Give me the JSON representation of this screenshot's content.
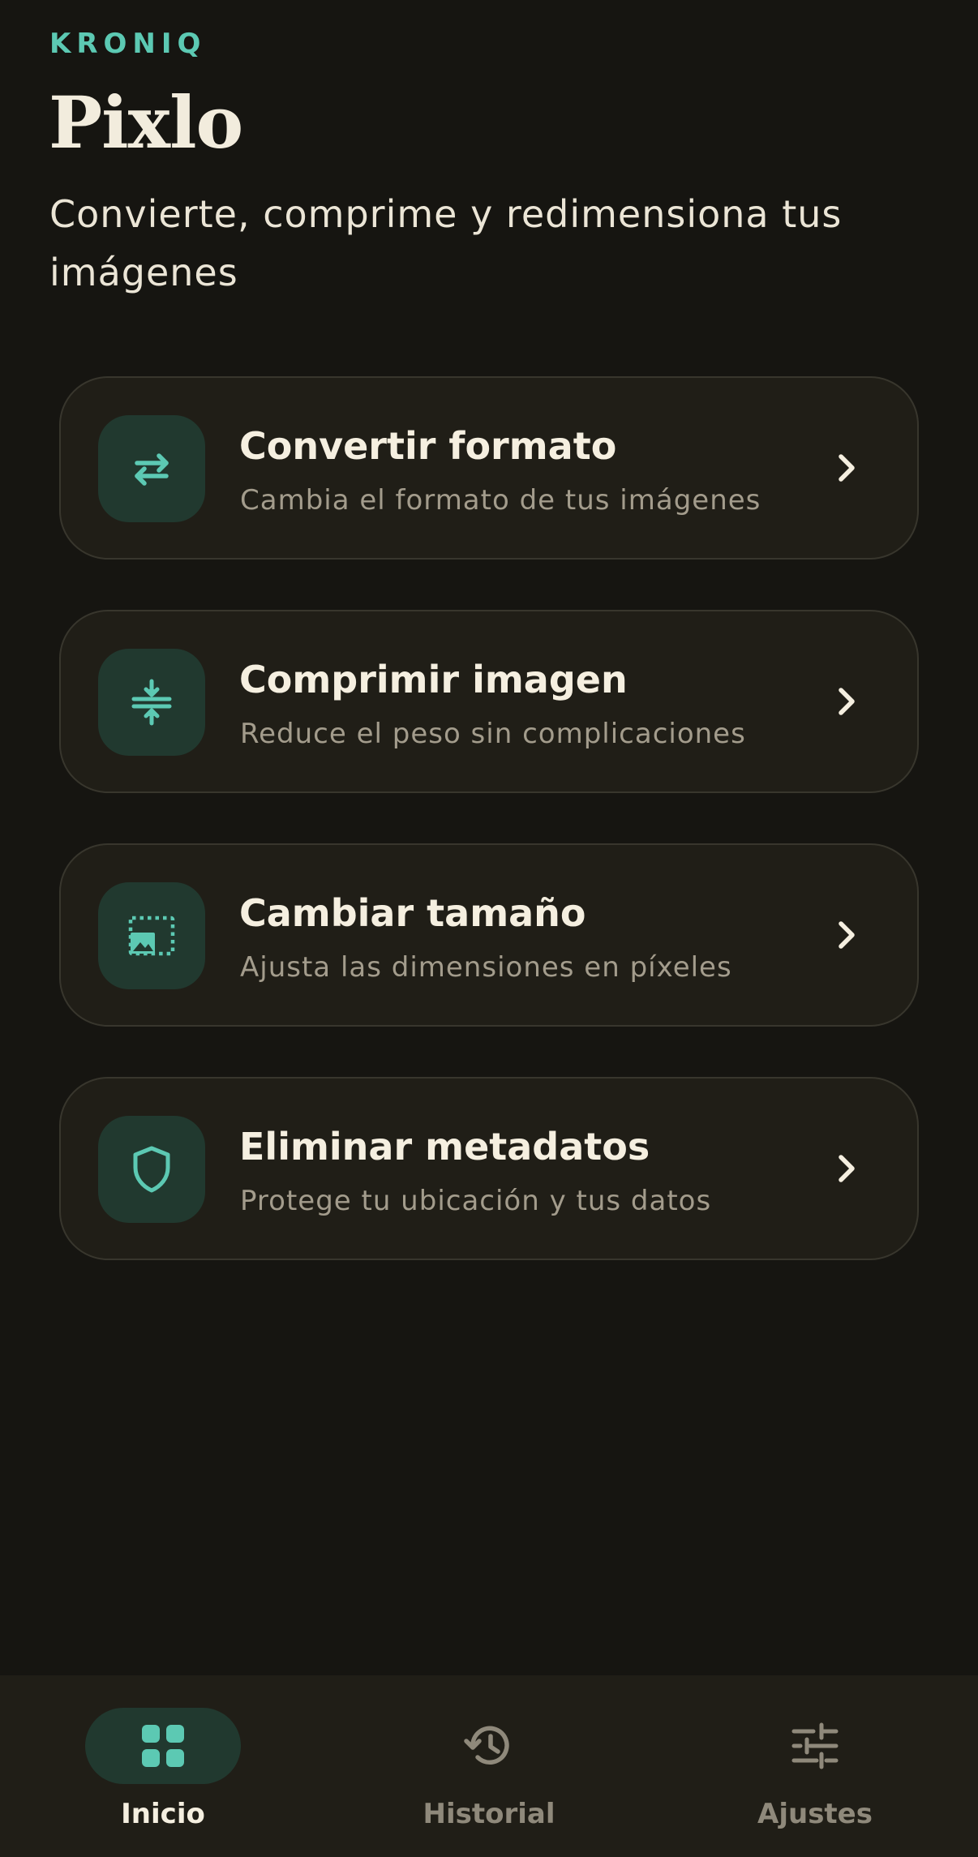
{
  "header": {
    "brand": "KRONIQ",
    "title": "Pixlo",
    "subtitle": "Convierte, comprime y redimensiona tus imágenes"
  },
  "tools": [
    {
      "title": "Convertir formato",
      "description": "Cambia el formato de tus imágenes",
      "icon": "swap-arrows-icon"
    },
    {
      "title": "Comprimir imagen",
      "description": "Reduce el peso sin complicaciones",
      "icon": "compress-icon"
    },
    {
      "title": "Cambiar tamaño",
      "description": "Ajusta las dimensiones en píxeles",
      "icon": "resize-image-icon"
    },
    {
      "title": "Eliminar metadatos",
      "description": "Protege tu ubicación y tus datos",
      "icon": "shield-icon"
    }
  ],
  "nav": {
    "items": [
      {
        "label": "Inicio",
        "icon": "grid-icon",
        "active": true
      },
      {
        "label": "Historial",
        "icon": "history-icon",
        "active": false
      },
      {
        "label": "Ajustes",
        "icon": "sliders-icon",
        "active": false
      }
    ]
  },
  "colors": {
    "background": "#161511",
    "accent": "#5cc9b3",
    "card": "#201e17",
    "icon_tile": "#21392f"
  }
}
